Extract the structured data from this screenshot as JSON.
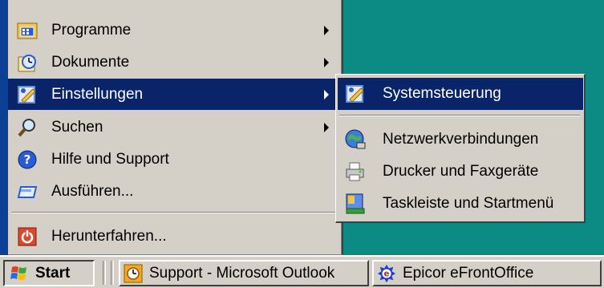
{
  "start_menu": {
    "items": [
      {
        "label": "Programme",
        "icon": "programs-icon",
        "has_submenu": true
      },
      {
        "label": "Dokumente",
        "icon": "documents-icon",
        "has_submenu": true
      },
      {
        "label": "Einstellungen",
        "icon": "settings-icon",
        "has_submenu": true
      },
      {
        "label": "Suchen",
        "icon": "search-icon",
        "has_submenu": true
      },
      {
        "label": "Hilfe und Support",
        "icon": "help-icon",
        "has_submenu": false
      },
      {
        "label": "Ausführen...",
        "icon": "run-icon",
        "has_submenu": false
      },
      {
        "label": "Herunterfahren...",
        "icon": "shutdown-icon",
        "has_submenu": false
      }
    ],
    "selected": "Einstellungen"
  },
  "submenu": {
    "items": [
      {
        "label": "Systemsteuerung",
        "icon": "control-panel-icon"
      },
      {
        "label": "Netzwerkverbindungen",
        "icon": "network-connections-icon"
      },
      {
        "label": "Drucker und Faxgeräte",
        "icon": "printer-icon"
      },
      {
        "label": "Taskleiste und Startmenü",
        "icon": "taskbar-icon"
      }
    ],
    "selected": "Systemsteuerung"
  },
  "taskbar": {
    "start_label": "Start",
    "tasks": [
      {
        "label": "Support - Microsoft Outlook",
        "icon": "outlook-icon"
      },
      {
        "label": "Epicor eFrontOffice",
        "icon": "epicor-icon"
      }
    ]
  },
  "colors": {
    "desktop": "#0b8b84",
    "menu_bg": "#d4d0c8",
    "highlight": "#0a246a"
  }
}
